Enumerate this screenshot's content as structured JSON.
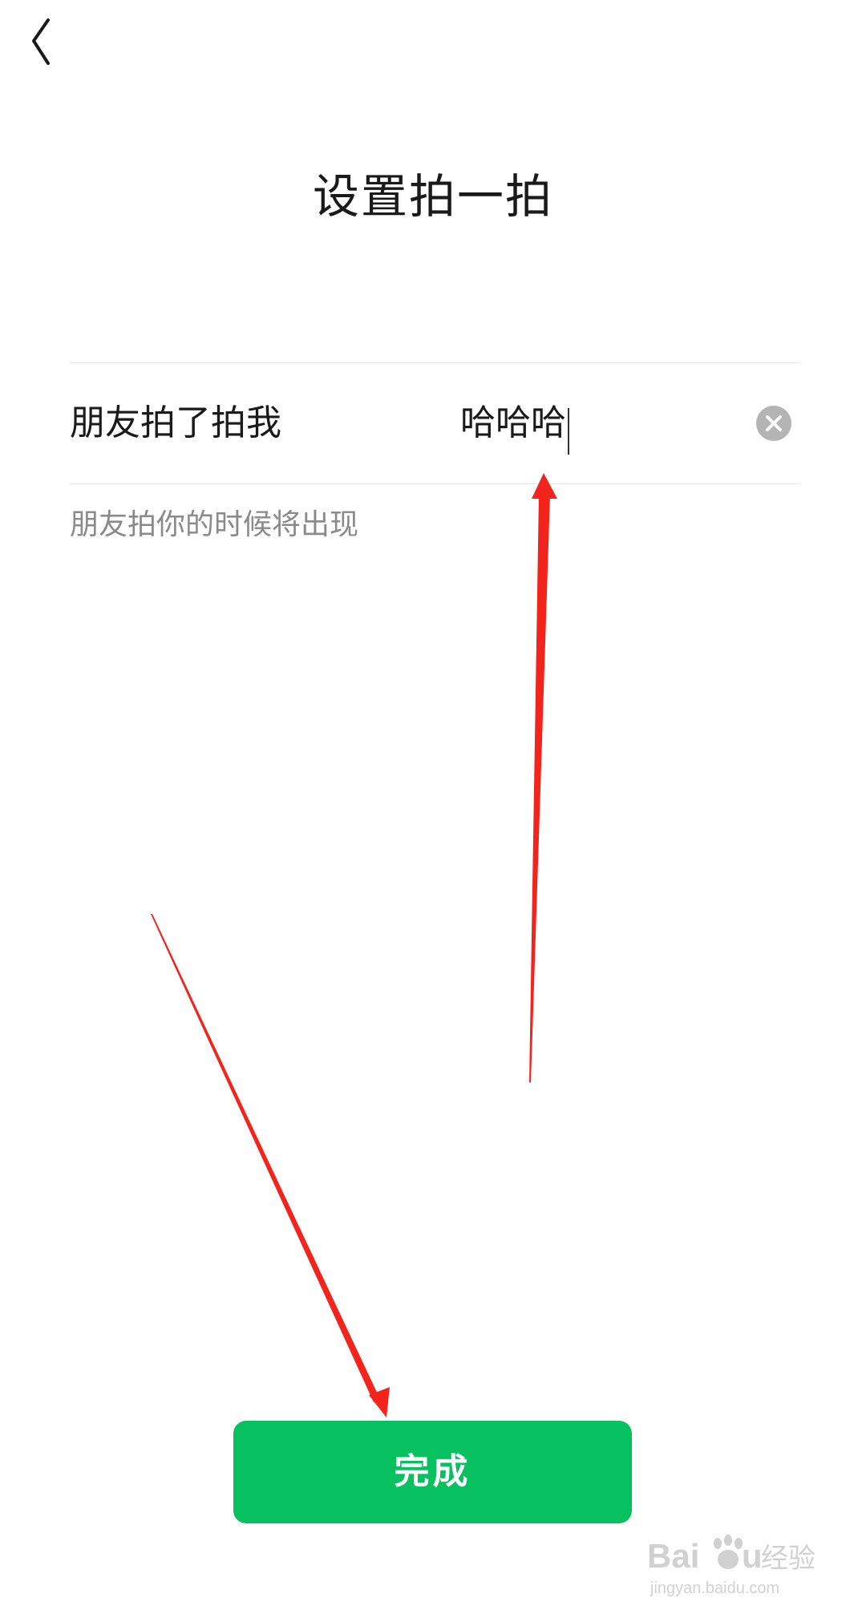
{
  "header": {
    "back_icon": "chevron-left-icon",
    "title": "设置拍一拍"
  },
  "pat_setting": {
    "label": "朋友拍了拍我",
    "input_value": "哈哈哈",
    "clear_icon": "clear-circle-icon",
    "helper": "朋友拍你的时候将出现"
  },
  "footer": {
    "done_label": "完成"
  },
  "annotations": {
    "arrow_color": "#f2241b"
  },
  "watermark": {
    "brand": "Baidu经验",
    "url": "jingyan.baidu.com"
  },
  "colors": {
    "accent": "#07c160",
    "text_primary": "#1a1a1a",
    "text_secondary": "#8a8a8a"
  }
}
